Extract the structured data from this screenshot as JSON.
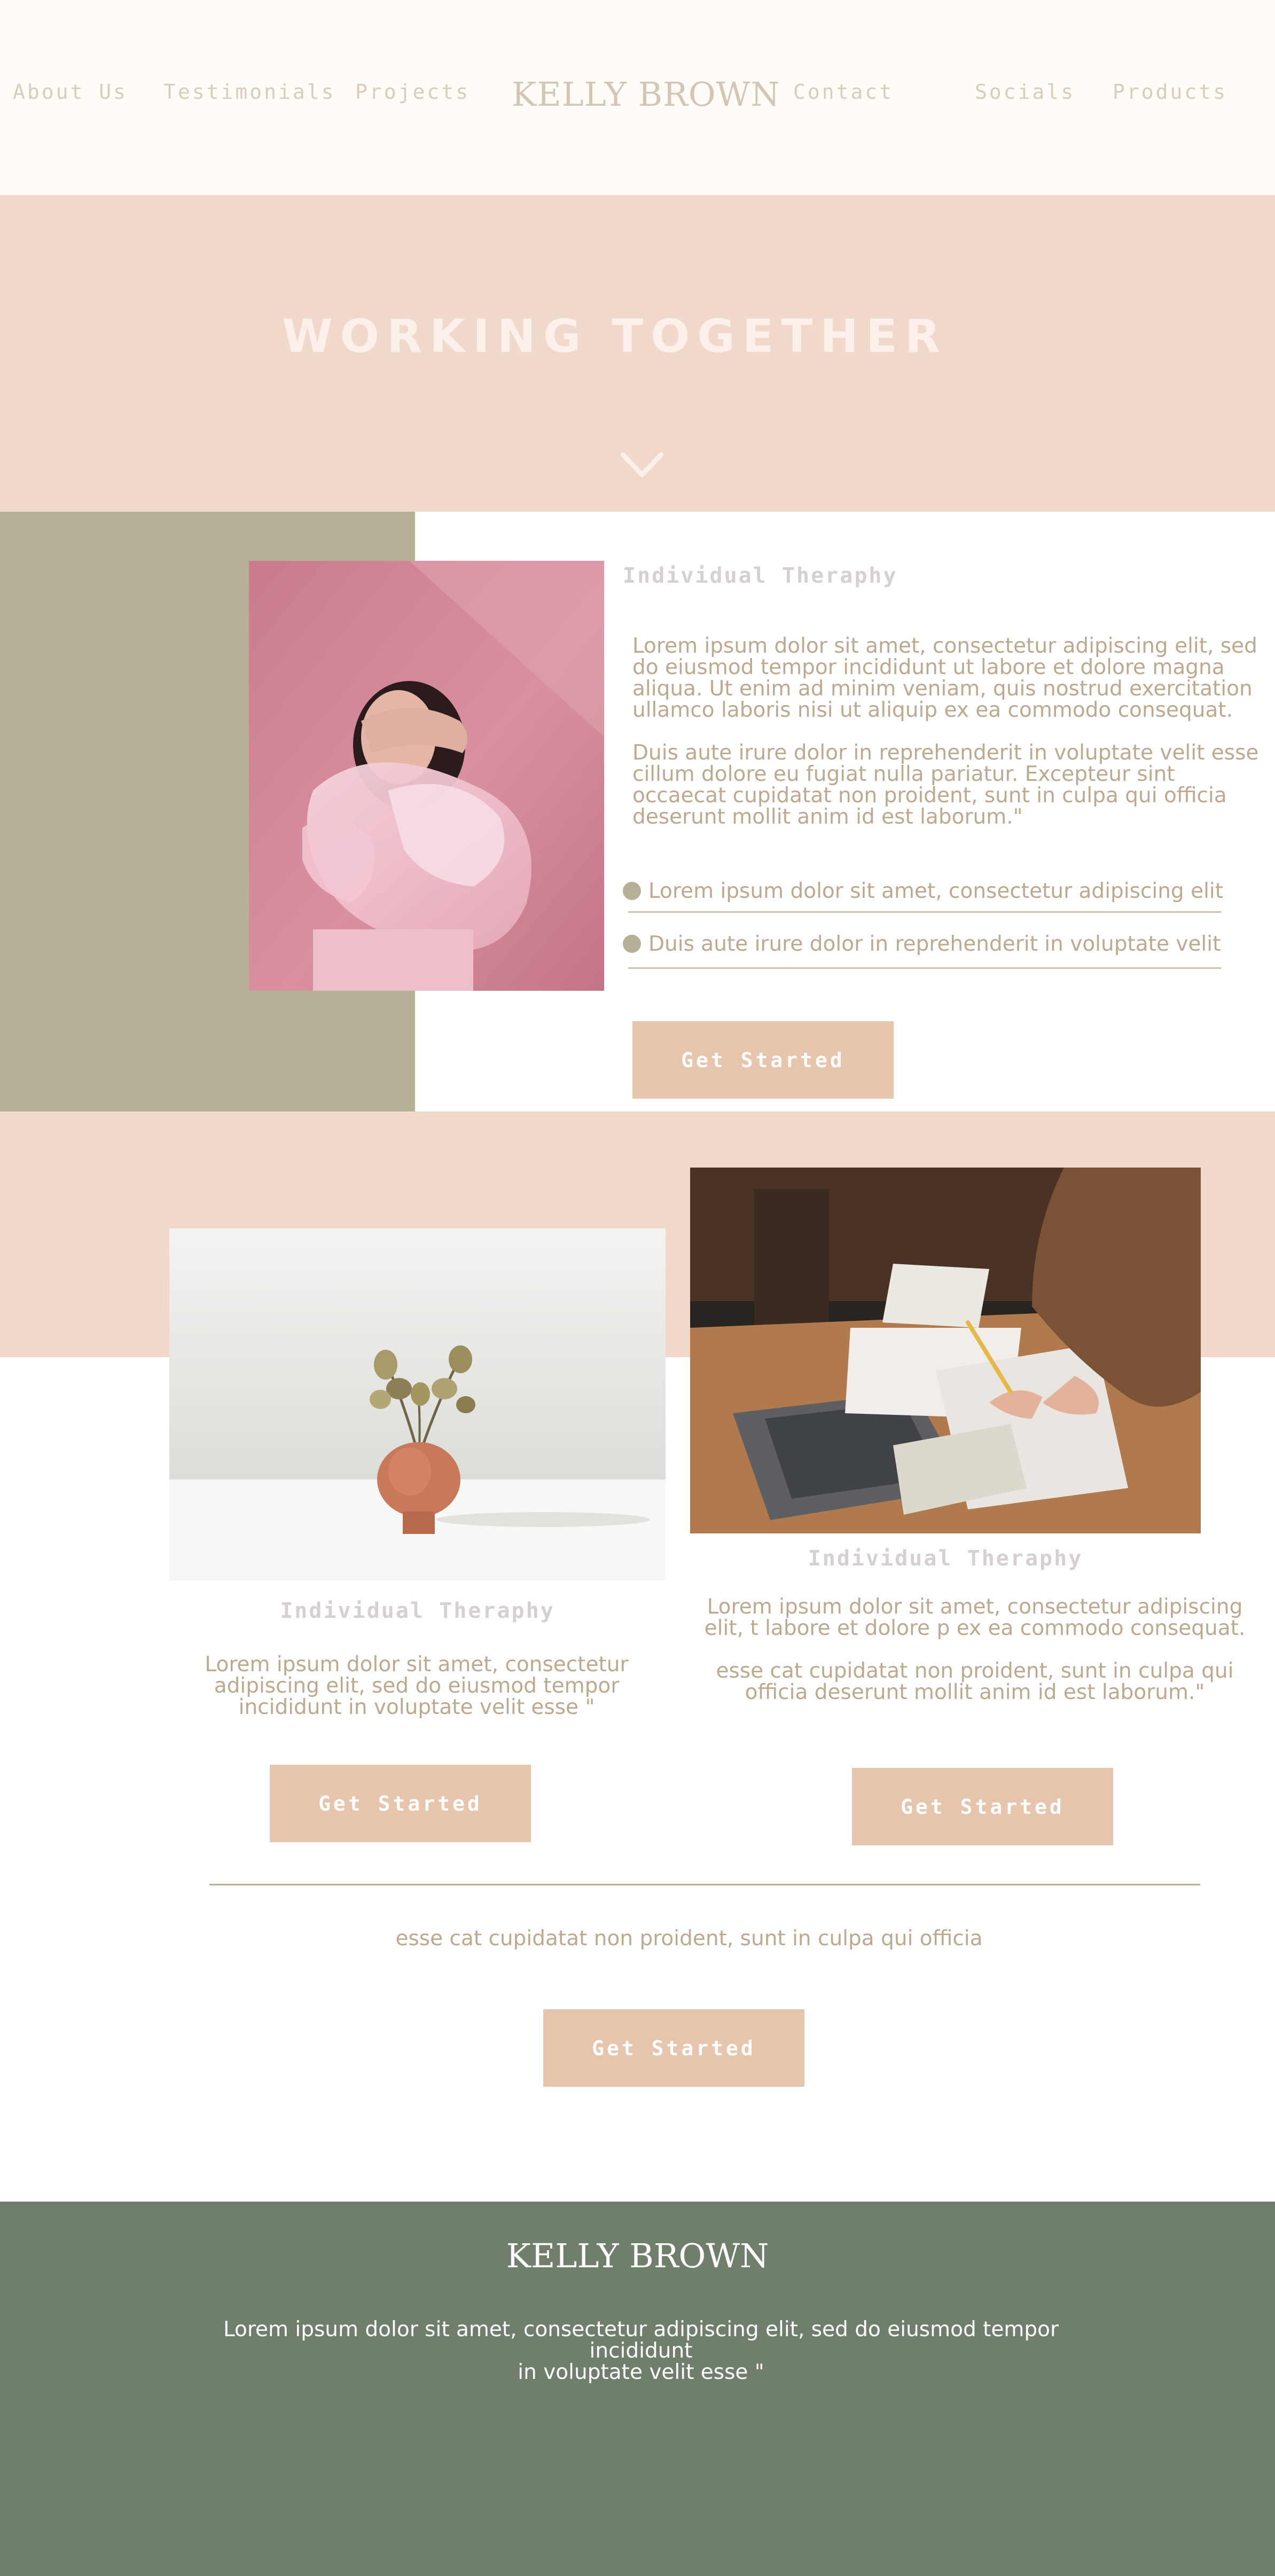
{
  "colors": {
    "header_bg": "#fffcf7",
    "blush": "#f0d8cb",
    "sage_block": "#b6b096",
    "cta_bg": "#e6c5ac",
    "body_text": "#bda98f",
    "footer_bg": "#6f7f6b"
  },
  "header": {
    "brand": "KELLY BROWN",
    "nav_left": [
      "About Us",
      "Testimonials",
      "Projects"
    ],
    "nav_right": [
      "Contact",
      "Socials",
      "Products"
    ]
  },
  "hero": {
    "title": "WORKING TOGETHER",
    "scroll_icon": "chevron-down-icon"
  },
  "feature": {
    "title": "Individual Theraphy",
    "paragraph_1": "Lorem ipsum dolor sit amet, consectetur adipiscing elit, sed do eiusmod tempor incididunt ut labore et dolore magna aliqua. Ut enim ad minim veniam, quis nostrud exercitation ullamco laboris nisi ut aliquip ex ea commodo consequat.",
    "paragraph_2": "Duis aute irure dolor in reprehenderit in voluptate velit esse cillum dolore eu fugiat nulla pariatur. Excepteur sint occaecat cupidatat non proident, sunt in culpa qui officia deserunt mollit anim id est laborum.\"",
    "bullets": [
      "Lorem ipsum dolor sit amet, consectetur adipiscing elit",
      "Duis aute irure dolor in reprehenderit  in voluptate velit"
    ],
    "cta": "Get Started"
  },
  "card_left": {
    "title": "Individual Theraphy",
    "text": "Lorem ipsum dolor sit amet, consectetur adipiscing elit, sed do eiusmod tempor incididunt in voluptate velit esse \"",
    "cta": "Get Started"
  },
  "card_right": {
    "title": "Individual Theraphy",
    "text_1": "Lorem ipsum dolor sit amet, consectetur adipiscing elit, t labore et dolore p ex ea commodo consequat.",
    "text_2": "esse cat cupidatat non proident, sunt in culpa qui officia deserunt mollit anim id est laborum.\"",
    "cta": "Get Started"
  },
  "closing": {
    "text": "esse cat cupidatat non proident, sunt in culpa qui officia",
    "cta": "Get Started"
  },
  "footer": {
    "brand": "KELLY BROWN",
    "line_1": "Lorem ipsum dolor sit amet, consectetur adipiscing elit, sed do eiusmod tempor incididunt",
    "line_2": "in voluptate velit esse \""
  }
}
